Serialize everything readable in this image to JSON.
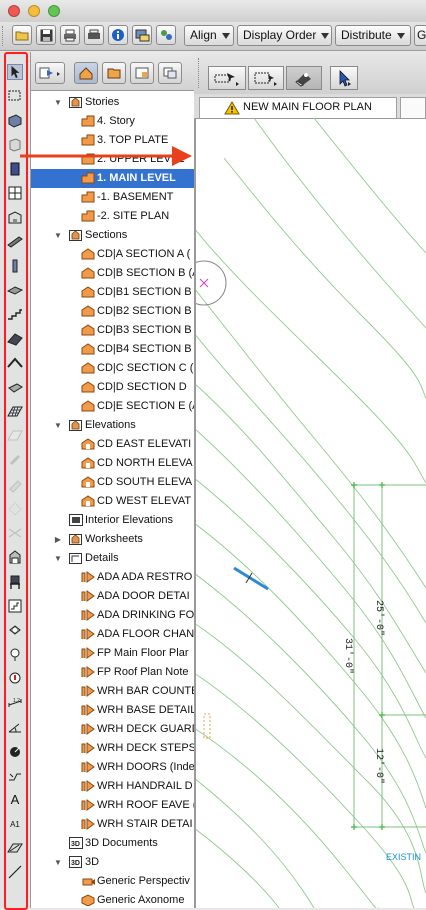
{
  "window": {
    "traffic_lights": [
      {
        "name": "close",
        "color": "#ee5a52"
      },
      {
        "name": "minimize",
        "color": "#f5bd3b"
      },
      {
        "name": "zoom",
        "color": "#62c554"
      }
    ]
  },
  "toolbar": {
    "icons": [
      "open-folder-icon",
      "save-icon",
      "print-icon",
      "plot-icon",
      "info-icon",
      "layout-book-icon",
      "teamwork-icon"
    ],
    "dropdowns": [
      {
        "label": "Align"
      },
      {
        "label": "Display Order"
      },
      {
        "label": "Distribute"
      },
      {
        "label": "G"
      }
    ]
  },
  "toolbox": {
    "highlight_color": "#ff1e1e",
    "tools": [
      "arrow-tool-icon",
      "marquee-tool-icon",
      "wall-tool-icon",
      "column-tool-icon",
      "door-tool-icon",
      "window-tool-icon",
      "curtain-wall-tool-icon",
      "beam-tool-icon",
      "column-round-tool-icon",
      "slab-tool-icon",
      "stair-tool-icon",
      "roof-tool-icon",
      "shell-tool-icon",
      "morph-tool-icon",
      "mesh-tool-icon",
      "zone-tool-icon",
      "skylight-tool-icon",
      "wall-end-tool-icon",
      "corner-window-tool-icon",
      "grid-tool-icon",
      "object-tool-icon",
      "chair-tool-icon",
      "stair-maker-tool-icon",
      "lamp-tool-icon",
      "light-tool-icon",
      "label-tool-icon",
      "dimension-tool-icon",
      "angle-dimension-tool-icon",
      "radial-dimension-tool-icon",
      "level-dimension-tool-icon",
      "text-tool-icon",
      "label-a1-tool-icon",
      "fill-tool-icon",
      "line-tool-icon"
    ],
    "text_tool_label": "A",
    "label_tool_label": "A1"
  },
  "navigator": {
    "tabs": [
      "project-map-icon",
      "view-map-icon",
      "layout-book-icon",
      "publisher-icon"
    ],
    "active_tab": 0,
    "items": [
      {
        "label": "Stories",
        "indent": 0,
        "type": "folder",
        "expanded": true
      },
      {
        "label": "4. Story",
        "indent": 1,
        "type": "story"
      },
      {
        "label": "3. TOP PLATE",
        "indent": 1,
        "type": "story"
      },
      {
        "label": "2. UPPER LEVEL",
        "indent": 1,
        "type": "story"
      },
      {
        "label": "1. MAIN LEVEL",
        "indent": 1,
        "type": "story",
        "selected": true
      },
      {
        "label": "-1. BASEMENT",
        "indent": 1,
        "type": "story"
      },
      {
        "label": "-2. SITE PLAN",
        "indent": 1,
        "type": "story"
      },
      {
        "label": "Sections",
        "indent": 0,
        "type": "folder",
        "expanded": true
      },
      {
        "label": "CD|A SECTION A (",
        "indent": 1,
        "type": "section"
      },
      {
        "label": "CD|B SECTION B (A",
        "indent": 1,
        "type": "section"
      },
      {
        "label": "CD|B1 SECTION B",
        "indent": 1,
        "type": "section"
      },
      {
        "label": "CD|B2 SECTION B",
        "indent": 1,
        "type": "section"
      },
      {
        "label": "CD|B3 SECTION B",
        "indent": 1,
        "type": "section"
      },
      {
        "label": "CD|B4 SECTION B",
        "indent": 1,
        "type": "section"
      },
      {
        "label": "CD|C SECTION C (",
        "indent": 1,
        "type": "section"
      },
      {
        "label": "CD|D SECTION D",
        "indent": 1,
        "type": "section"
      },
      {
        "label": "CD|E SECTION E (A",
        "indent": 1,
        "type": "section"
      },
      {
        "label": "Elevations",
        "indent": 0,
        "type": "folder",
        "expanded": true
      },
      {
        "label": "CD EAST ELEVATI",
        "indent": 1,
        "type": "elevation"
      },
      {
        "label": "CD NORTH ELEVA",
        "indent": 1,
        "type": "elevation"
      },
      {
        "label": "CD SOUTH ELEVA",
        "indent": 1,
        "type": "elevation"
      },
      {
        "label": "CD WEST ELEVAT",
        "indent": 1,
        "type": "elevation"
      },
      {
        "label": "Interior Elevations",
        "indent": 0,
        "type": "interior"
      },
      {
        "label": "Worksheets",
        "indent": 0,
        "type": "folder",
        "expanded": false
      },
      {
        "label": "Details",
        "indent": 0,
        "type": "folder",
        "expanded": true
      },
      {
        "label": "ADA ADA RESTRO",
        "indent": 1,
        "type": "detail"
      },
      {
        "label": "ADA DOOR DETAI",
        "indent": 1,
        "type": "detail"
      },
      {
        "label": "ADA DRINKING FO",
        "indent": 1,
        "type": "detail"
      },
      {
        "label": "ADA FLOOR CHAN",
        "indent": 1,
        "type": "detail"
      },
      {
        "label": "FP Main Floor Plar",
        "indent": 1,
        "type": "detail"
      },
      {
        "label": "FP Roof Plan Note",
        "indent": 1,
        "type": "detail"
      },
      {
        "label": "WRH BAR COUNTE",
        "indent": 1,
        "type": "detail"
      },
      {
        "label": "WRH BASE DETAIL",
        "indent": 1,
        "type": "detail"
      },
      {
        "label": "WRH DECK GUARD",
        "indent": 1,
        "type": "detail"
      },
      {
        "label": "WRH DECK STEPS",
        "indent": 1,
        "type": "detail"
      },
      {
        "label": "WRH DOORS (Inde",
        "indent": 1,
        "type": "detail"
      },
      {
        "label": "WRH HANDRAIL D",
        "indent": 1,
        "type": "detail"
      },
      {
        "label": "WRH ROOF EAVE (",
        "indent": 1,
        "type": "detail"
      },
      {
        "label": "WRH STAIR DETAI",
        "indent": 1,
        "type": "detail"
      },
      {
        "label": "3D Documents",
        "indent": 0,
        "type": "doc3d"
      },
      {
        "label": "3D",
        "indent": 0,
        "type": "folder",
        "expanded": true
      },
      {
        "label": "Generic Perspectiv",
        "indent": 1,
        "type": "camera"
      },
      {
        "label": "Generic Axonome",
        "indent": 1,
        "type": "axon"
      }
    ]
  },
  "canvas": {
    "tools": [
      "pet-palette-pointer-icon",
      "pet-palette-marquee-icon",
      "pet-palette-eraser-icon",
      "pet-palette-arrow-icon"
    ],
    "tab_title": "NEW MAIN FLOOR PLAN",
    "dims": [
      "25'-0\"",
      "31'-0\"",
      "12'-0\""
    ],
    "existing_label": "EXISTIN",
    "arrow_color": "#e8401c",
    "line_color": "#7fbf7f"
  }
}
